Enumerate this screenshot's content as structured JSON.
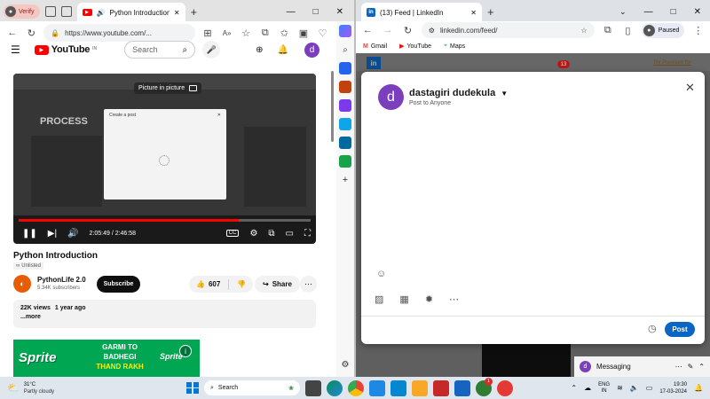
{
  "left_browser": {
    "profile_label": "Verify",
    "tab_title": "Python Introduction - YouTube",
    "url": "https://www.youtube.com/...",
    "youtube": {
      "logo_text": "YouTube",
      "region": "IN",
      "search_placeholder": "Search",
      "avatar_letter": "d",
      "pip_tooltip": "Picture in picture",
      "time_display": "2:05:49 / 2:46:58",
      "progress": 0.754,
      "embedded_dialog_title": "Create a post",
      "embedded_brand": "PROCESS",
      "video_title": "Python Introduction",
      "unlisted_label": "Unlisted",
      "channel_name": "PythonLife 2.0",
      "subscribers": "5.34K subscribers",
      "subscribe_label": "Subscribe",
      "likes": "607",
      "share_label": "Share",
      "views": "22K views",
      "upload_age": "1 year ago",
      "more_label": "...more",
      "ad": {
        "brand": "Sprite",
        "line1": "GARMI TO",
        "line2": "BADHEGI",
        "line3": "THAND RAKH",
        "brand_right": "Sprite"
      }
    }
  },
  "right_browser": {
    "tab_title": "(13) Feed | LinkedIn",
    "url": "linkedin.com/feed/",
    "paused_label": "Paused",
    "bookmarks": [
      {
        "label": "Gmail",
        "color": "#ea4335"
      },
      {
        "label": "YouTube",
        "color": "#ff0000"
      },
      {
        "label": "Maps",
        "color": "#34a853"
      }
    ],
    "notification_count": "13",
    "premium_teaser": "Try Premium for",
    "post_dialog": {
      "avatar_letter": "d",
      "author_name": "dastagiri dudekula",
      "audience": "Post to Anyone",
      "post_label": "Post"
    },
    "messaging_label": "Messaging"
  },
  "taskbar": {
    "weather_temp": "31°C",
    "weather_desc": "Partly cloudy",
    "search_label": "Search",
    "lang_line1": "ENG",
    "lang_line2": "IN",
    "time": "19:30",
    "date": "17-03-2024",
    "badge_count": "1"
  },
  "colors": {
    "youtube_red": "#ff0000",
    "linkedin_blue": "#0a66c2",
    "avatar_purple": "#7b3fbd",
    "sprite_green": "#00a651"
  }
}
